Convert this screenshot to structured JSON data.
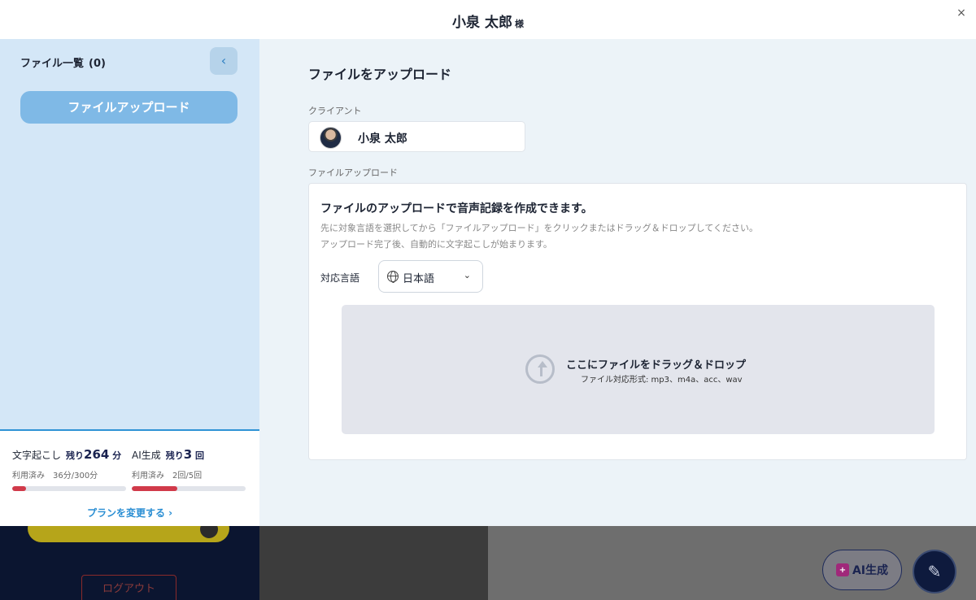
{
  "header": {
    "name": "小泉 太郎",
    "honorific": "様",
    "close_label": "×"
  },
  "sidebar": {
    "title": "ファイル一覧",
    "count": "(0)",
    "collapse_label": "‹",
    "upload_button": "ファイルアップロード",
    "usage": {
      "transcription": {
        "label": "文字起こし",
        "remain_prefix": "残り",
        "remain_value": "264",
        "remain_unit": "分",
        "used_text": "利用済み　36分/300分",
        "used_fraction": 0.12
      },
      "ai": {
        "label": "AI生成",
        "remain_prefix": "残り",
        "remain_value": "3",
        "remain_unit": "回",
        "used_text": "利用済み　2回/5回",
        "used_fraction": 0.4
      },
      "plan_link": "プランを変更する ›"
    }
  },
  "main": {
    "title": "ファイルをアップロード",
    "client_label": "クライアント",
    "client_name": "小泉 太郎",
    "upload_label": "ファイルアップロード",
    "card": {
      "title": "ファイルのアップロードで音声記録を作成できます。",
      "desc1": "先に対象言語を選択してから「ファイルアップロード」をクリックまたはドラッグ＆ドロップしてください。",
      "desc2": "アップロード完了後、自動的に文字起こしが始まります。",
      "lang_label": "対応言語",
      "lang_value": "日本語",
      "dropzone_title": "ここにファイルをドラッグ＆ドロップ",
      "dropzone_sub": "ファイル対応形式: mp3、m4a、acc、wav"
    }
  },
  "background": {
    "logout": "ログアウト",
    "ai_button": "AI生成",
    "ai_badge": "+"
  },
  "colors": {
    "sidebar_bg": "#d4e7f7",
    "main_bg": "#ecf3f8",
    "accent": "#2f93d5",
    "usage_bar": "#d13a4a"
  }
}
